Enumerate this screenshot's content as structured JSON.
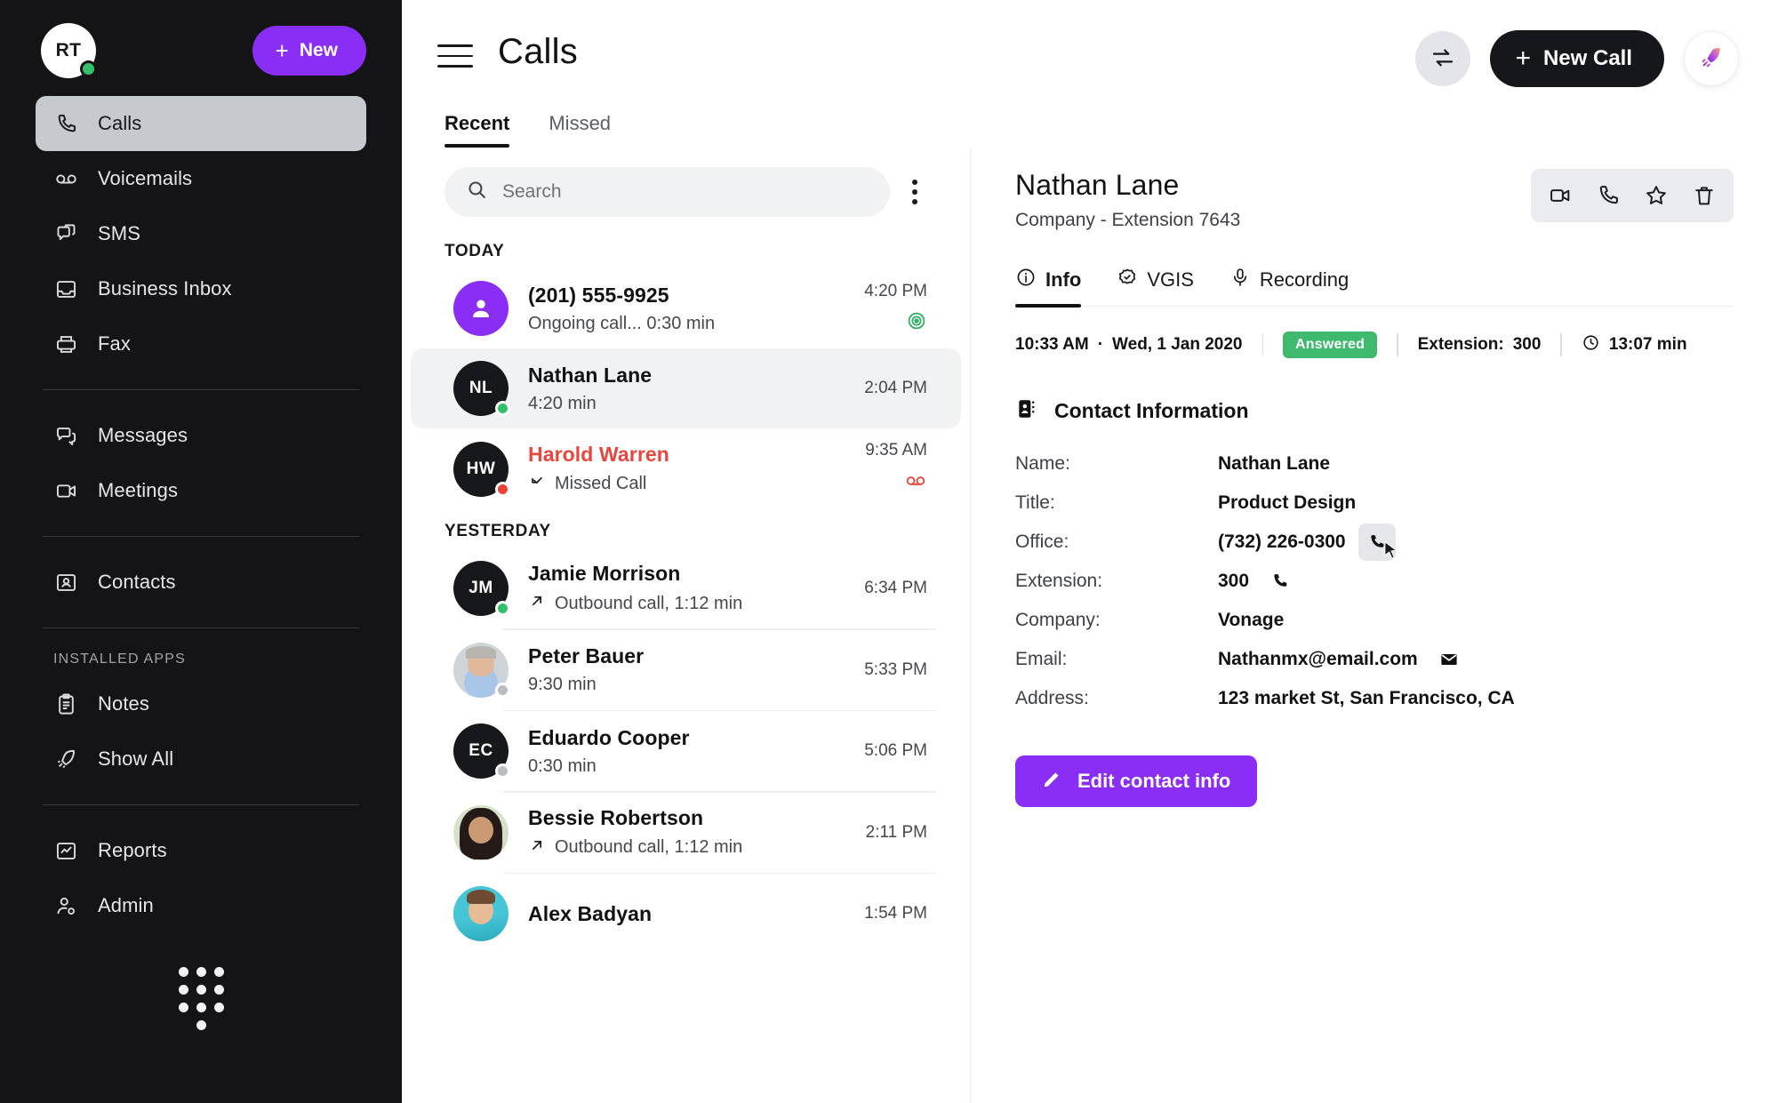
{
  "sidebar": {
    "user": {
      "initials": "RT",
      "presence": "online"
    },
    "new_button": {
      "label": "New",
      "icon": "plus-icon"
    },
    "primary_items": [
      {
        "label": "Calls",
        "icon": "phone-icon",
        "active": true
      },
      {
        "label": "Voicemails",
        "icon": "voicemail-icon",
        "active": false
      },
      {
        "label": "SMS",
        "icon": "sms-icon",
        "active": false
      },
      {
        "label": "Business Inbox",
        "icon": "inbox-icon",
        "active": false
      },
      {
        "label": "Fax",
        "icon": "fax-icon",
        "active": false
      }
    ],
    "comm_items": [
      {
        "label": "Messages",
        "icon": "chat-icon"
      },
      {
        "label": "Meetings",
        "icon": "video-icon"
      }
    ],
    "contacts_items": [
      {
        "label": "Contacts",
        "icon": "contact-card-icon"
      }
    ],
    "apps_section_label": "INSTALLED APPS",
    "apps_items": [
      {
        "label": "Notes",
        "icon": "clipboard-icon"
      },
      {
        "label": "Show All",
        "icon": "rocket-icon"
      }
    ],
    "footer_items": [
      {
        "label": "Reports",
        "icon": "chart-icon"
      },
      {
        "label": "Admin",
        "icon": "user-gear-icon"
      }
    ],
    "dialpad_icon": "dialpad-icon"
  },
  "header": {
    "menu_icon": "hamburger-icon",
    "title": "Calls",
    "transfer_icon": "transfer-icon",
    "new_call_label": "New Call",
    "new_call_icon": "plus-icon",
    "rocket_icon": "rocket-icon"
  },
  "tabs": [
    {
      "label": "Recent",
      "active": true
    },
    {
      "label": "Missed",
      "active": false
    }
  ],
  "list": {
    "search": {
      "placeholder": "Search",
      "value": "",
      "icon": "search-icon"
    },
    "kebab_icon": "more-vertical-icon",
    "groups": [
      {
        "label": "TODAY",
        "rows": [
          {
            "name": "(201) 555-9925",
            "subtitle": "Ongoing call... 0:30 min",
            "time": "4:20 PM",
            "avatar_type": "icon",
            "avatar_initials": "",
            "avatar_color": "#8b2ef5",
            "presence": "none",
            "status_icon": "recording-active-icon",
            "missed": false,
            "direction_icon": "none",
            "selected": false,
            "separator": false
          },
          {
            "name": "Nathan Lane",
            "subtitle": "4:20 min",
            "time": "2:04 PM",
            "avatar_type": "initials",
            "avatar_initials": "NL",
            "avatar_color": "#17181b",
            "presence": "online",
            "status_icon": "none",
            "missed": false,
            "direction_icon": "none",
            "selected": true,
            "separator": false
          },
          {
            "name": "Harold Warren",
            "subtitle": "Missed Call",
            "time": "9:35 AM",
            "avatar_type": "initials",
            "avatar_initials": "HW",
            "avatar_color": "#17181b",
            "presence": "busy",
            "status_icon": "voicemail-icon",
            "missed": true,
            "direction_icon": "missed-arrow-icon",
            "selected": false,
            "separator": false
          }
        ]
      },
      {
        "label": "YESTERDAY",
        "rows": [
          {
            "name": "Jamie Morrison",
            "subtitle": "Outbound call, 1:12 min",
            "time": "6:34 PM",
            "avatar_type": "initials",
            "avatar_initials": "JM",
            "avatar_color": "#17181b",
            "presence": "online",
            "status_icon": "none",
            "missed": false,
            "direction_icon": "outbound-arrow-icon",
            "selected": false,
            "separator": true
          },
          {
            "name": "Peter Bauer",
            "subtitle": "9:30 min",
            "time": "5:33 PM",
            "avatar_type": "photo",
            "avatar_photo": "p1",
            "avatar_initials": "",
            "avatar_color": "#cfd4d8",
            "presence": "offline",
            "status_icon": "none",
            "missed": false,
            "direction_icon": "none",
            "selected": false,
            "separator": true
          },
          {
            "name": "Eduardo Cooper",
            "subtitle": "0:30 min",
            "time": "5:06 PM",
            "avatar_type": "initials",
            "avatar_initials": "EC",
            "avatar_color": "#17181b",
            "presence": "offline",
            "status_icon": "none",
            "missed": false,
            "direction_icon": "none",
            "selected": false,
            "separator": true
          },
          {
            "name": "Bessie Robertson",
            "subtitle": "Outbound call, 1:12 min",
            "time": "2:11 PM",
            "avatar_type": "photo",
            "avatar_photo": "p2",
            "avatar_initials": "",
            "avatar_color": "#d5e3c8",
            "presence": "none",
            "status_icon": "none",
            "missed": false,
            "direction_icon": "outbound-arrow-icon",
            "selected": false,
            "separator": true
          },
          {
            "name": "Alex Badyan",
            "subtitle": "",
            "time": "1:54 PM",
            "avatar_type": "photo",
            "avatar_photo": "p3",
            "avatar_initials": "",
            "avatar_color": "#45c5d6",
            "presence": "none",
            "status_icon": "none",
            "missed": false,
            "direction_icon": "none",
            "selected": false,
            "separator": true
          }
        ]
      }
    ]
  },
  "detail": {
    "name": "Nathan Lane",
    "subtitle": "Company -  Extension 7643",
    "actions": [
      {
        "icon": "video-camera-icon",
        "name": "video-call"
      },
      {
        "icon": "phone-icon",
        "name": "call"
      },
      {
        "icon": "star-icon",
        "name": "favorite"
      },
      {
        "icon": "trash-icon",
        "name": "delete"
      }
    ],
    "tabs": [
      {
        "label": "Info",
        "icon": "info-icon",
        "active": true
      },
      {
        "label": "VGIS",
        "icon": "vgis-icon",
        "active": false
      },
      {
        "label": "Recording",
        "icon": "microphone-icon",
        "active": false
      }
    ],
    "meta": {
      "time": "10:33 AM",
      "separator_dot": "·",
      "date": "Wed, 1 Jan 2020",
      "status_badge": "Answered",
      "status_color": "#3fb96e",
      "extension_label": "Extension:",
      "extension_value": "300",
      "duration": "13:07 min",
      "clock_icon": "clock-icon"
    },
    "section": {
      "title": "Contact Information",
      "icon": "contact-card-icon"
    },
    "fields": [
      {
        "label": "Name:",
        "value": "Nathan Lane",
        "icon": "none"
      },
      {
        "label": "Title:",
        "value": "Product  Design",
        "icon": "none"
      },
      {
        "label": "Office:",
        "value": "(732) 226-0300",
        "icon": "phone-icon",
        "icon_hover": true
      },
      {
        "label": "Extension:",
        "value": "300",
        "icon": "phone-icon",
        "icon_hover": false
      },
      {
        "label": "Company:",
        "value": "Vonage",
        "icon": "none"
      },
      {
        "label": "Email:",
        "value": "Nathanmx@email.com",
        "icon": "envelope-icon",
        "icon_hover": false
      },
      {
        "label": "Address:",
        "value": "123 market St, San Francisco, CA",
        "icon": "none"
      }
    ],
    "edit_button": {
      "label": "Edit contact info",
      "icon": "pencil-icon"
    }
  },
  "colors": {
    "accent_purple": "#8b2ef5",
    "sidebar_bg": "#141416",
    "active_nav": "#c6cace",
    "missed_red": "#e8453c",
    "answered_green": "#3fb96e"
  }
}
